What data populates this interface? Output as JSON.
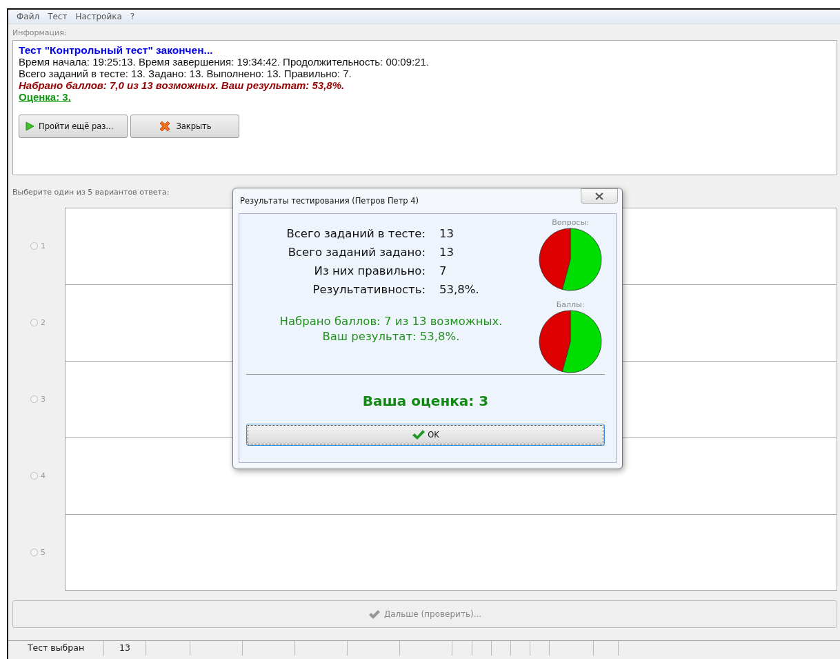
{
  "menu": [
    {
      "label": "Файл"
    },
    {
      "label": "Тест"
    },
    {
      "label": "Настройка"
    },
    {
      "label": "?"
    }
  ],
  "info": {
    "label": "Информация:",
    "lines": [
      {
        "kind": "title",
        "text": "Тест \"Контрольный тест\" закончен..."
      },
      {
        "kind": "text",
        "text": "Время начала: 19:25:13. Время завершения: 19:34:42. Продолжительность: 00:09:21."
      },
      {
        "kind": "text",
        "text": "Всего заданий в тесте: 13. Задано: 13. Выполнено: 13. Правильно: 7."
      },
      {
        "kind": "score",
        "text": "Набрано баллов: 7,0 из 13 возможных. Ваш результат: 53,8%."
      },
      {
        "kind": "grade",
        "text": "Оценка: 3."
      }
    ],
    "buttons": [
      {
        "kind": "retry",
        "label": "Пройти ещё раз..."
      },
      {
        "kind": "close",
        "label": "Закрыть"
      }
    ]
  },
  "answers": {
    "label": "Выберите один из 5 вариантов ответа:",
    "options": [
      {
        "label": "1",
        "selected": false
      },
      {
        "label": "2",
        "selected": false
      },
      {
        "label": "3",
        "selected": false
      },
      {
        "label": "4",
        "selected": false
      },
      {
        "label": "5",
        "selected": false
      }
    ]
  },
  "next_button": {
    "label": "Дальше (проверить)...",
    "disabled": true
  },
  "status_bar": {
    "cells": [
      "Тест выбран",
      "13"
    ]
  },
  "dialog": {
    "title": "Результаты тестирования (Петров Петр 4)",
    "stats": [
      {
        "label": "Всего заданий в тесте:",
        "value": "13"
      },
      {
        "label": "Всего заданий задано:",
        "value": "13"
      },
      {
        "label": "Из них правильно:",
        "value": "7"
      },
      {
        "label": "Результативность:",
        "value": "53,8%."
      }
    ],
    "summary": [
      "Набрано баллов: 7 из 13 возможных.",
      "Ваш результат: 53,8%."
    ],
    "grade": "Ваша оценка: 3",
    "pies": [
      {
        "label": "Вопросы:"
      },
      {
        "label": "Баллы:"
      }
    ],
    "ok_button": "OK"
  }
}
